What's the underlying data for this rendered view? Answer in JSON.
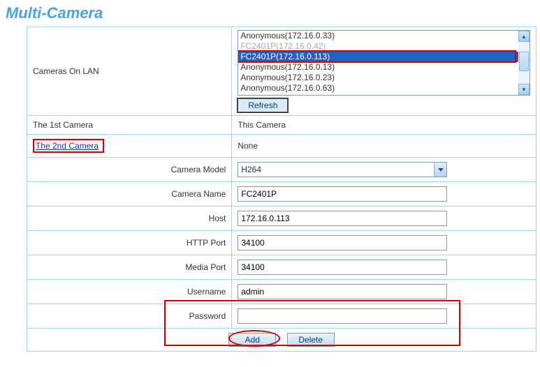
{
  "title": "Multi-Camera",
  "labels": {
    "cameras_on_lan": "Cameras On LAN",
    "first_camera": "The 1st Camera",
    "second_camera": "The 2nd Camera",
    "camera_model": "Camera Model",
    "camera_name": "Camera Name",
    "host": "Host",
    "http_port": "HTTP Port",
    "media_port": "Media Port",
    "username": "Username",
    "password": "Password"
  },
  "lan": {
    "items": [
      {
        "label": "Anonymous(172.16.0.33)",
        "dim": false
      },
      {
        "label": "FC2401P(172.16.0.42)",
        "dim": true
      },
      {
        "label": "FC2401P(172.16.0.113)",
        "selected": true
      },
      {
        "label": "Anonymous(172.16.0.13)",
        "dim": false
      },
      {
        "label": "Anonymous(172.16.0.23)",
        "dim": false
      },
      {
        "label": "Anonymous(172.16.0.63)",
        "dim": false
      }
    ]
  },
  "buttons": {
    "refresh": "Refresh",
    "add": "Add",
    "delete": "Delete"
  },
  "values": {
    "first_camera": "This Camera",
    "second_camera": "None",
    "camera_model": "H264",
    "camera_name": "FC2401P",
    "host": "172.16.0.113",
    "http_port": "34100",
    "media_port": "34100",
    "username": "admin",
    "password": ""
  }
}
